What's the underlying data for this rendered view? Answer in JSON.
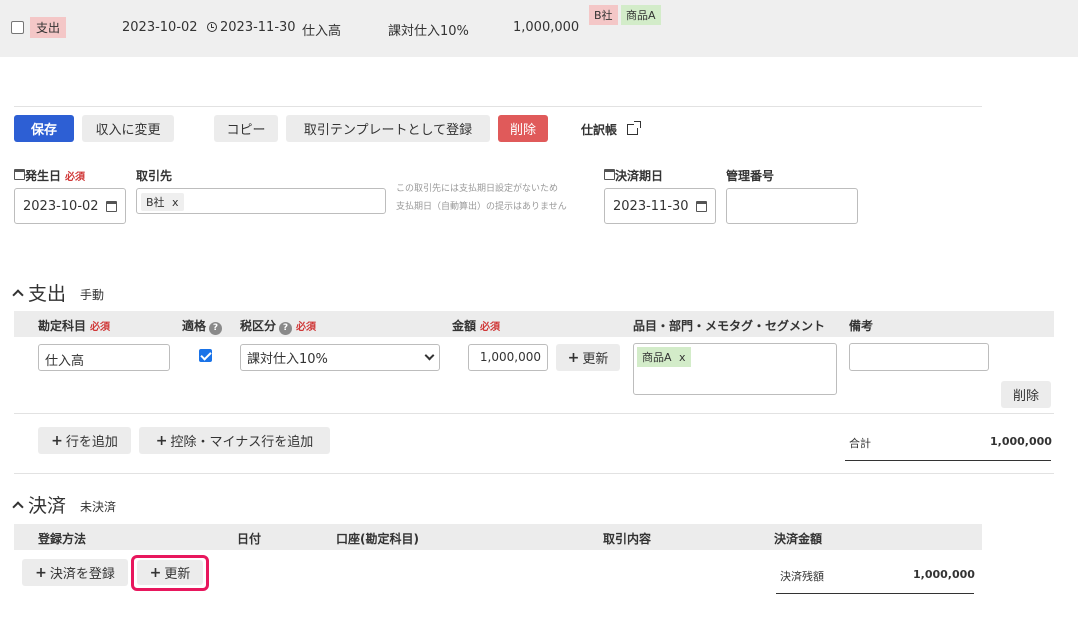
{
  "summary_row": {
    "type_tag": "支出",
    "issue_date": "2023-10-02",
    "due_date": "2023-11-30",
    "account": "仕入高",
    "tax": "課対仕入10%",
    "amount": "1,000,000",
    "partner_tag": "B社",
    "item_tag": "商品A"
  },
  "toolbar": {
    "save": "保存",
    "change_to_income": "収入に変更",
    "copy": "コピー",
    "register_template": "取引テンプレートとして登録",
    "delete": "削除",
    "journal": "仕訳帳"
  },
  "form": {
    "issue_date_label": "発生日",
    "required": "必須",
    "issue_date_value": "2023-10-02",
    "partner_label": "取引先",
    "partner_tag": "B社",
    "partner_tag_remove": "x",
    "partner_note_line1": "この取引先には支払期日設定がないため",
    "partner_note_line2": "支払期日（自動算出）の提示はありません",
    "due_date_label": "決済期日",
    "due_date_value": "2023-11-30",
    "control_number_label": "管理番号",
    "control_number_value": ""
  },
  "expense_section": {
    "title": "支出",
    "mode": "手動",
    "headers": {
      "account": "勘定科目",
      "qualified": "適格",
      "tax_category": "税区分",
      "amount": "金額",
      "tags": "品目・部門・メモタグ・セグメント",
      "remarks": "備考"
    },
    "row": {
      "account": "仕入高",
      "qualified_checked": true,
      "tax_category": "課対仕入10%",
      "amount": "1,000,000",
      "update": "更新",
      "item_tag": "商品A",
      "item_tag_remove": "x",
      "remarks": "",
      "delete": "削除"
    },
    "add_row": "行を追加",
    "add_deduction_row": "控除・マイナス行を追加",
    "total_label": "合計",
    "total_value": "1,000,000"
  },
  "settlement_section": {
    "title": "決済",
    "status": "未決済",
    "headers": {
      "method": "登録方法",
      "date": "日付",
      "account": "口座(勘定科目)",
      "description": "取引内容",
      "amount": "決済金額"
    },
    "register": "決済を登録",
    "update": "更新",
    "balance_label": "決済残額",
    "balance_value": "1,000,000"
  },
  "icons": {
    "calendar": "calendar-icon",
    "clock": "clock-icon",
    "help": "help-icon",
    "external_link": "external-link-icon",
    "plus": "plus-icon",
    "chevron_up": "chevron-up-icon"
  },
  "colors": {
    "primary": "#2d5fd4",
    "danger": "#e05a5a",
    "highlight": "#e8175d",
    "expense_tag": "#f4c7c7",
    "item_tag": "#d3ecc9"
  }
}
